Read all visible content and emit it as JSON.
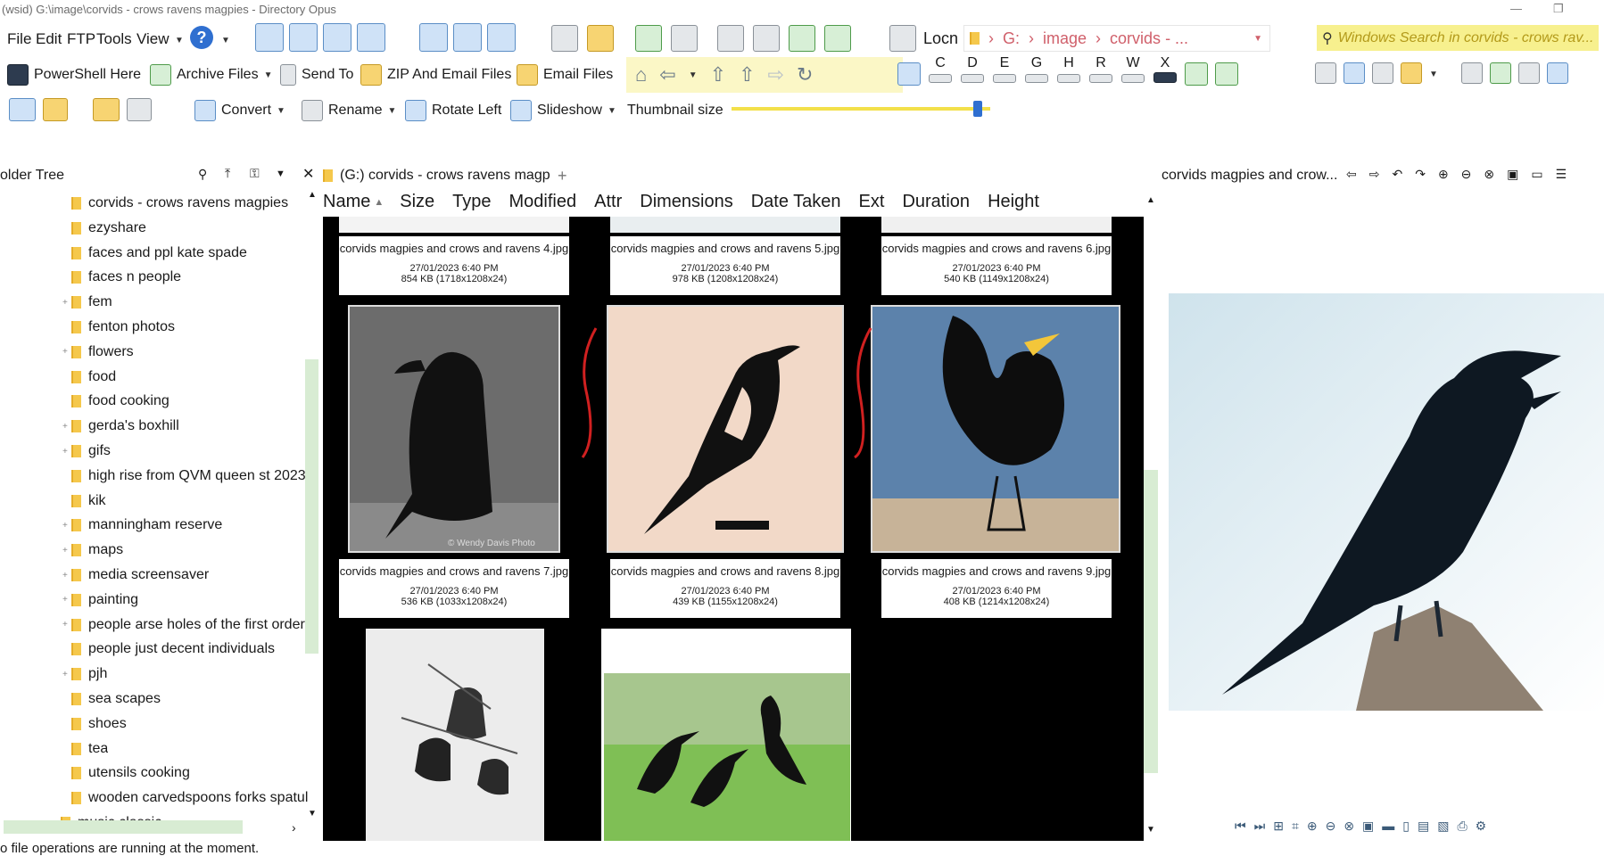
{
  "window": {
    "title": "(wsid) G:\\image\\corvids - crows ravens magpies - Directory Opus"
  },
  "menubar": [
    "File",
    "Edit",
    "FTP",
    "Tools",
    "View"
  ],
  "toolbar2": {
    "powershell": "PowerShell Here",
    "archive": "Archive Files",
    "sendto": "Send To",
    "zip_email": "ZIP And Email Files",
    "email": "Email Files"
  },
  "toolbar3": {
    "convert": "Convert",
    "rename": "Rename",
    "rotate": "Rotate Left",
    "slideshow": "Slideshow",
    "thumb_size": "Thumbnail size",
    "thumb_level": 0.95
  },
  "location": {
    "label": "Locn",
    "breadcrumb": [
      "G:",
      "image",
      "corvids - ..."
    ]
  },
  "drives": [
    "C",
    "D",
    "E",
    "G",
    "H",
    "R",
    "W",
    "X"
  ],
  "search": {
    "placeholder": "Windows Search in corvids - crows rav..."
  },
  "folder_tree": {
    "title": "older Tree",
    "items": [
      {
        "label": "corvids - crows ravens magpies",
        "expand": false,
        "selected": true
      },
      {
        "label": "ezyshare",
        "expand": false
      },
      {
        "label": "faces and ppl kate spade",
        "expand": false
      },
      {
        "label": "faces n people",
        "expand": false
      },
      {
        "label": "fem",
        "expand": true
      },
      {
        "label": "fenton photos",
        "expand": false
      },
      {
        "label": "flowers",
        "expand": true
      },
      {
        "label": "food",
        "expand": false
      },
      {
        "label": "food cooking",
        "expand": false
      },
      {
        "label": "gerda's boxhill",
        "expand": true
      },
      {
        "label": "gifs",
        "expand": true
      },
      {
        "label": "high rise from QVM queen st 2023",
        "expand": false
      },
      {
        "label": "kik",
        "expand": false
      },
      {
        "label": "manningham reserve",
        "expand": true
      },
      {
        "label": "maps",
        "expand": true
      },
      {
        "label": "media screensaver",
        "expand": true
      },
      {
        "label": "painting",
        "expand": true
      },
      {
        "label": "people arse holes of the first order",
        "expand": true
      },
      {
        "label": "people just decent individuals",
        "expand": false
      },
      {
        "label": "pjh",
        "expand": true
      },
      {
        "label": "sea scapes",
        "expand": false
      },
      {
        "label": "shoes",
        "expand": false
      },
      {
        "label": "tea",
        "expand": false
      },
      {
        "label": "utensils cooking",
        "expand": false
      },
      {
        "label": "wooden carvedspoons forks spatula",
        "expand": false
      },
      {
        "label": "music classic",
        "expand": false
      }
    ]
  },
  "file_tab": {
    "label": "(G:) corvids - crows ravens magpies"
  },
  "columns": [
    "Name",
    "Size",
    "Type",
    "Modified",
    "Attr",
    "Dimensions",
    "Date Taken",
    "Ext",
    "Duration",
    "Height"
  ],
  "files_row1": [
    {
      "name": "corvids magpies and crows and ravens 4.jpg",
      "date": "27/01/2023 6:40 PM",
      "size": "854 KB (1718x1208x24)"
    },
    {
      "name": "corvids magpies and crows and ravens 5.jpg",
      "date": "27/01/2023 6:40 PM",
      "size": "978 KB (1208x1208x24)"
    },
    {
      "name": "corvids magpies and crows and ravens 6.jpg",
      "date": "27/01/2023 6:40 PM",
      "size": "540 KB (1149x1208x24)"
    }
  ],
  "files_row2": [
    {
      "name": "corvids magpies and crows and ravens 7.jpg",
      "date": "27/01/2023 6:40 PM",
      "size": "536 KB (1033x1208x24)"
    },
    {
      "name": "corvids magpies and crows and ravens 8.jpg",
      "date": "27/01/2023 6:40 PM",
      "size": "439 KB (1155x1208x24)"
    },
    {
      "name": "corvids magpies and crows and ravens 9.jpg",
      "date": "27/01/2023 6:40 PM",
      "size": "408 KB (1214x1208x24)"
    }
  ],
  "watermark": "© Wendy Davis Photo",
  "preview": {
    "title": "corvids magpies and crow..."
  },
  "status": {
    "text": "o file operations are running at the moment."
  }
}
